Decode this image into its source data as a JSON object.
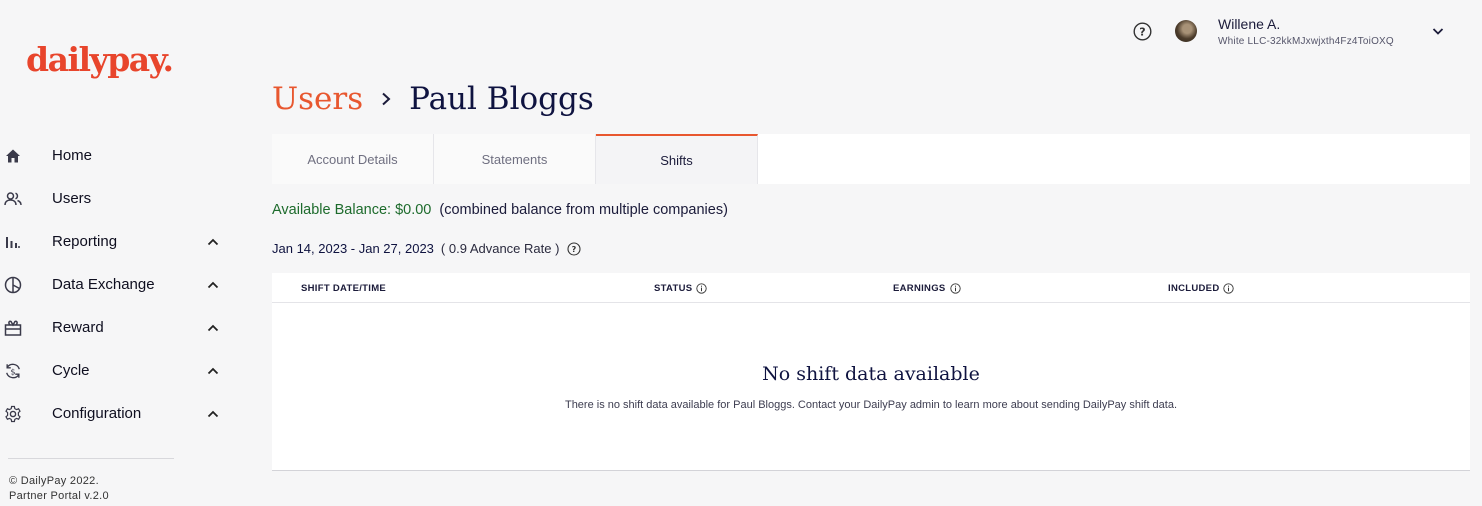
{
  "brand": {
    "logo_text": "dailypay.",
    "accent": "#e8452c"
  },
  "sidebar": {
    "items": [
      {
        "label": "Home",
        "icon": "home-icon",
        "expandable": false
      },
      {
        "label": "Users",
        "icon": "users-icon",
        "expandable": false
      },
      {
        "label": "Reporting",
        "icon": "reporting-icon",
        "expandable": true
      },
      {
        "label": "Data Exchange",
        "icon": "data-exchange-icon",
        "expandable": true
      },
      {
        "label": "Reward",
        "icon": "reward-icon",
        "expandable": true
      },
      {
        "label": "Cycle",
        "icon": "cycle-icon",
        "expandable": true
      },
      {
        "label": "Configuration",
        "icon": "gear-icon",
        "expandable": true
      }
    ],
    "footer": {
      "copyright": "© DailyPay 2022.",
      "version": "Partner Portal v.2.0"
    }
  },
  "header": {
    "user_name": "Willene A.",
    "user_org": "White LLC-32kkMJxwjxth4Fz4ToiOXQ"
  },
  "breadcrumb": {
    "parent": "Users",
    "current": "Paul Bloggs"
  },
  "tabs": [
    {
      "label": "Account Details",
      "active": false
    },
    {
      "label": "Statements",
      "active": false
    },
    {
      "label": "Shifts",
      "active": true
    }
  ],
  "balance": {
    "label": "Available Balance: $0.00",
    "description": "(combined balance from multiple companies)",
    "color": "#1d6b2c"
  },
  "period": {
    "dates": "Jan 14, 2023 - Jan 27, 2023",
    "rate": "( 0.9 Advance Rate )"
  },
  "table": {
    "columns": [
      "SHIFT DATE/TIME",
      "STATUS",
      "EARNINGS",
      "INCLUDED"
    ],
    "empty_title": "No shift data available",
    "empty_text": "There is no shift data available for Paul Bloggs. Contact your DailyPay admin to learn more about sending DailyPay shift data."
  }
}
